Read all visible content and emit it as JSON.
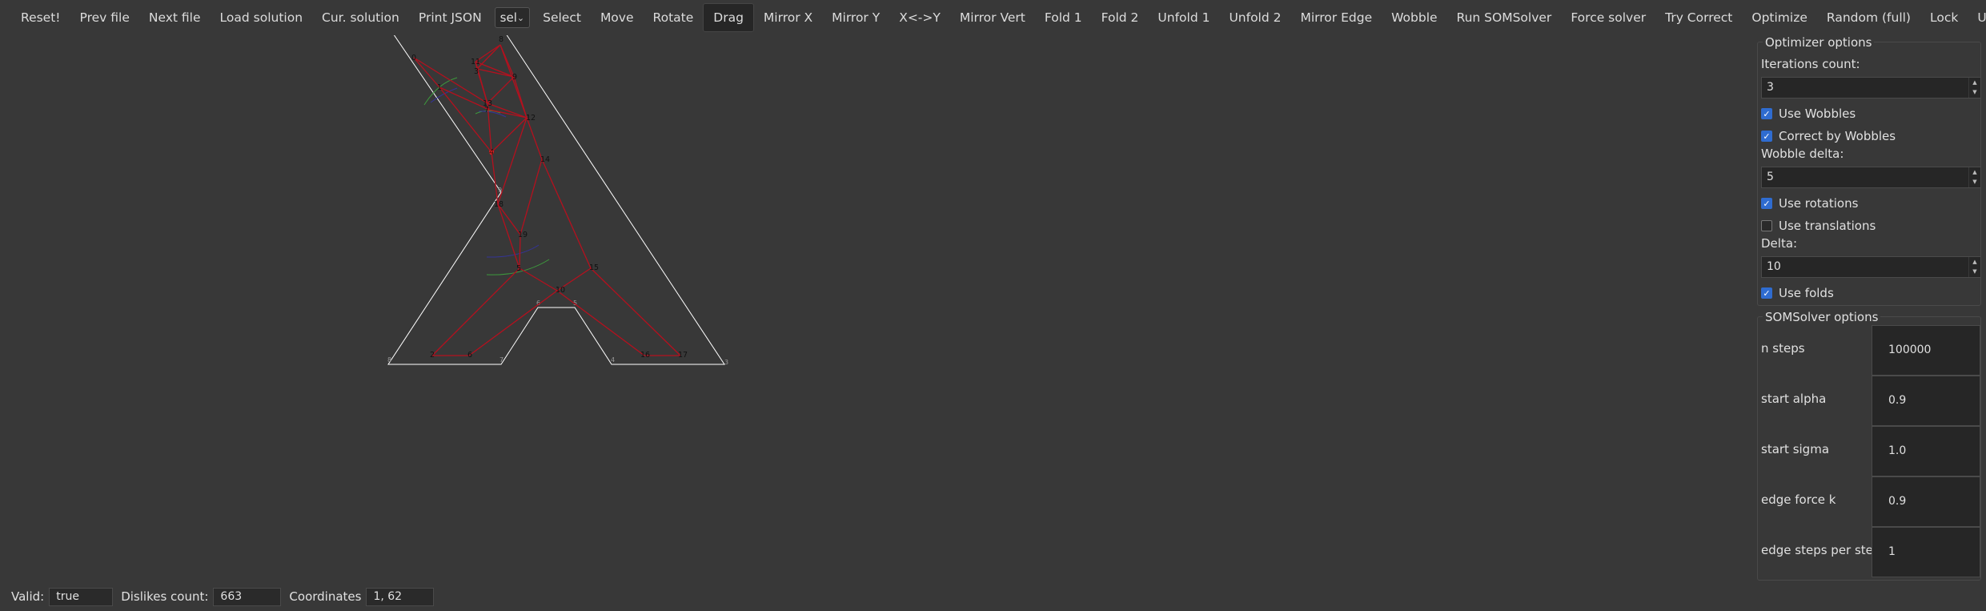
{
  "toolbar": {
    "reset": "Reset!",
    "prev_file": "Prev file",
    "next_file": "Next file",
    "load_solution": "Load solution",
    "cur_solution": "Cur. solution",
    "print_json": "Print JSON",
    "mode_select_value": "sel",
    "select": "Select",
    "move": "Move",
    "rotate": "Rotate",
    "drag": "Drag",
    "mirror_x": "Mirror X",
    "mirror_y": "Mirror Y",
    "swap_xy": "X<->Y",
    "mirror_vert": "Mirror Vert",
    "fold1": "Fold 1",
    "fold2": "Fold 2",
    "unfold1": "Unfold 1",
    "unfold2": "Unfold 2",
    "mirror_edge": "Mirror Edge",
    "wobble": "Wobble",
    "run_som": "Run SOMSolver",
    "force_solver": "Force solver",
    "try_correct": "Try Correct",
    "optimize": "Optimize",
    "random_full": "Random (full)",
    "lock": "Lock",
    "unlock": "Unlock",
    "active_tool": "drag"
  },
  "optimizer": {
    "title": "Optimizer options",
    "iterations_label": "Iterations count:",
    "iterations_value": "3",
    "use_wobbles_label": "Use Wobbles",
    "use_wobbles": true,
    "correct_by_wobbles_label": "Correct by Wobbles",
    "correct_by_wobbles": true,
    "wobble_delta_label": "Wobble delta:",
    "wobble_delta_value": "5",
    "use_rotations_label": "Use rotations",
    "use_rotations": true,
    "use_translations_label": "Use translations",
    "use_translations": false,
    "delta_label": "Delta:",
    "delta_value": "10",
    "use_folds_label": "Use folds",
    "use_folds": true
  },
  "som": {
    "title": "SOMSolver options",
    "n_steps_label": "n steps",
    "n_steps_value": "100000",
    "start_alpha_label": "start alpha",
    "start_alpha_value": "0.9",
    "start_sigma_label": "start sigma",
    "start_sigma_value": "1.0",
    "edge_force_k_label": "edge force k",
    "edge_force_k_value": "0.9",
    "edge_steps_label": "edge steps per step",
    "edge_steps_value": "1"
  },
  "status": {
    "valid_label": "Valid:",
    "valid_value": "true",
    "dislikes_label": "Dislikes count:",
    "dislikes_value": "663",
    "coords_label": "Coordinates",
    "coords_value": "1, 62"
  },
  "figure": {
    "hole_color": "#ffffff",
    "edge_color": "#b5101e",
    "selected_vertex_color": "#ff2020",
    "hole_vertex_labels": [
      "1",
      "2",
      "3",
      "4",
      "5",
      "6",
      "7",
      "8",
      "9"
    ],
    "figure_vertex_labels": [
      "0",
      "1",
      "2",
      "3",
      "4",
      "5",
      "6",
      "7",
      "8",
      "9",
      "10",
      "11",
      "12",
      "13",
      "14",
      "15",
      "16",
      "17",
      "18",
      "19"
    ]
  }
}
